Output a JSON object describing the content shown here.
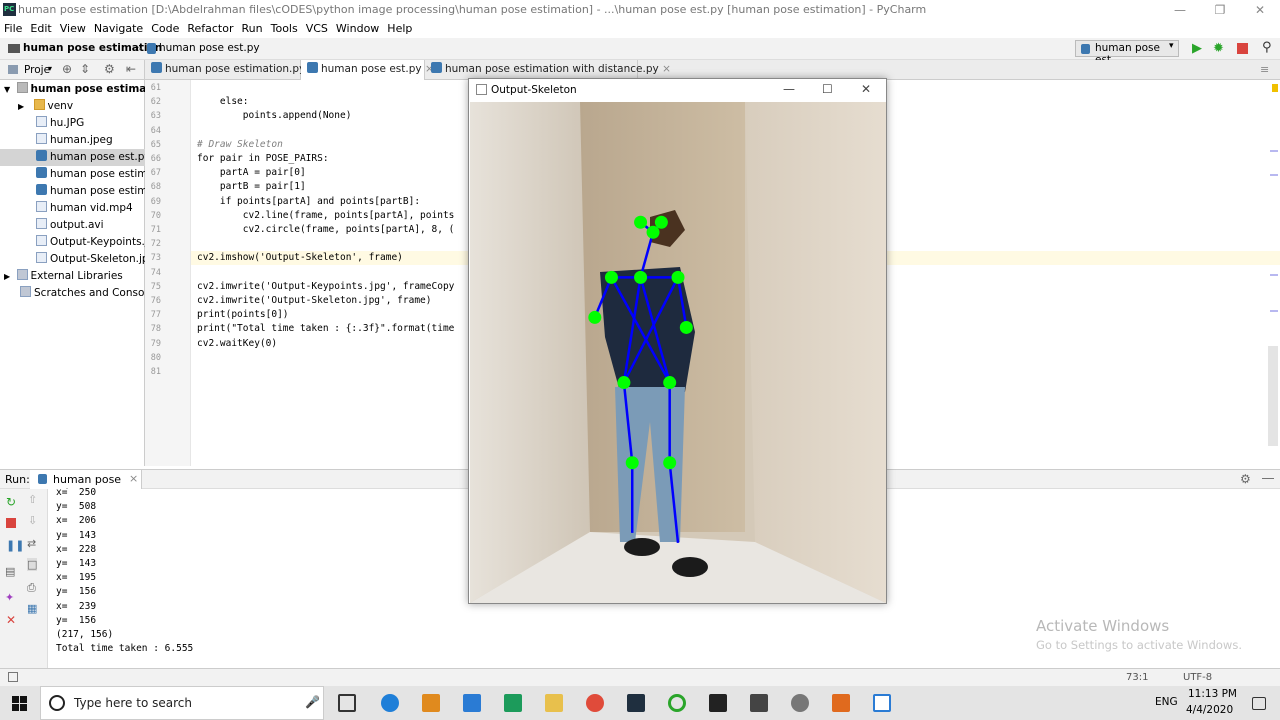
{
  "window": {
    "title": "human pose estimation [D:\\Abdelrahman files\\cODES\\python image processing\\human pose estimation] - ...\\human pose est.py [human pose estimation] - PyCharm"
  },
  "menu": [
    "File",
    "Edit",
    "View",
    "Navigate",
    "Code",
    "Refactor",
    "Run",
    "Tools",
    "VCS",
    "Window",
    "Help"
  ],
  "breadcrumb": {
    "project": "human pose estimation",
    "file": "human pose est.py"
  },
  "run_config": "human pose est",
  "project_panel_label": "Proje",
  "tree": [
    {
      "label": "human pose estimation",
      "type": "root"
    },
    {
      "label": "venv",
      "type": "folder"
    },
    {
      "label": "hu.JPG",
      "type": "file"
    },
    {
      "label": "human.jpeg",
      "type": "file"
    },
    {
      "label": "human pose est.py",
      "type": "py"
    },
    {
      "label": "human pose estimatio",
      "type": "py"
    },
    {
      "label": "human pose estimatio",
      "type": "py"
    },
    {
      "label": "human vid.mp4",
      "type": "file"
    },
    {
      "label": "output.avi",
      "type": "file"
    },
    {
      "label": "Output-Keypoints.jpg",
      "type": "file"
    },
    {
      "label": "Output-Skeleton.jpg",
      "type": "file"
    },
    {
      "label": "External Libraries",
      "type": "lib"
    },
    {
      "label": "Scratches and Consoles",
      "type": "lib"
    }
  ],
  "tabs": [
    "human pose estimation.py",
    "human pose est.py",
    "human pose estimation with distance.py"
  ],
  "line_numbers": [
    "61",
    "62",
    "63",
    "64",
    "65",
    "66",
    "67",
    "68",
    "69",
    "70",
    "71",
    "72",
    "73",
    "74",
    "75",
    "76",
    "77",
    "78",
    "79",
    "80",
    "81"
  ],
  "code": [
    "",
    "    else:",
    "        points.append(None)",
    "",
    "# Draw Skeleton",
    "for pair in POSE_PAIRS:",
    "    partA = pair[0]",
    "    partB = pair[1]",
    "    if points[partA] and points[partB]:",
    "        cv2.line(frame, points[partA], points",
    "        cv2.circle(frame, points[partA], 8, (",
    "",
    "cv2.imshow('Output-Skeleton', frame)",
    "",
    "cv2.imwrite('Output-Keypoints.jpg', frameCopy",
    "cv2.imwrite('Output-Skeleton.jpg', frame)",
    "print(points[0])",
    "print(\"Total time taken : {:.3f}\".format(time",
    "cv2.waitKey(0)",
    "",
    ""
  ],
  "run": {
    "label": "Run:",
    "tab": "human pose est",
    "output": [
      "x=  250",
      "y=  508",
      "x=  206",
      "y=  143",
      "x=  228",
      "y=  143",
      "x=  195",
      "y=  156",
      "x=  239",
      "y=  156",
      "(217, 156)",
      "Total time taken : 6.555"
    ]
  },
  "cv_window": {
    "title": "Output-Skeleton"
  },
  "skeleton": {
    "points": [
      {
        "x": 0.41,
        "y": 0.24
      },
      {
        "x": 0.46,
        "y": 0.24
      },
      {
        "x": 0.44,
        "y": 0.26
      },
      {
        "x": 0.34,
        "y": 0.35
      },
      {
        "x": 0.41,
        "y": 0.35
      },
      {
        "x": 0.5,
        "y": 0.35
      },
      {
        "x": 0.3,
        "y": 0.43
      },
      {
        "x": 0.52,
        "y": 0.45
      },
      {
        "x": 0.37,
        "y": 0.56
      },
      {
        "x": 0.48,
        "y": 0.56
      },
      {
        "x": 0.39,
        "y": 0.72
      },
      {
        "x": 0.48,
        "y": 0.72
      }
    ],
    "lines": [
      [
        0,
        2
      ],
      [
        1,
        2
      ],
      [
        2,
        4
      ],
      [
        3,
        4
      ],
      [
        4,
        5
      ],
      [
        3,
        6
      ],
      [
        5,
        7
      ],
      [
        4,
        8
      ],
      [
        4,
        9
      ],
      [
        8,
        10
      ],
      [
        9,
        11
      ],
      [
        10,
        10
      ],
      [
        3,
        9
      ],
      [
        5,
        8
      ]
    ],
    "joint_color": "#00ff00",
    "bone_color": "#0000ff"
  },
  "status": {
    "position": "73:1",
    "encoding": "UTF-8"
  },
  "taskbar": {
    "search_placeholder": "Type here to search",
    "time": "11:13 PM",
    "date": "4/4/2020",
    "lang": "ENG"
  },
  "watermark": {
    "line1": "Activate Windows",
    "line2": "Go to Settings to activate Windows."
  }
}
